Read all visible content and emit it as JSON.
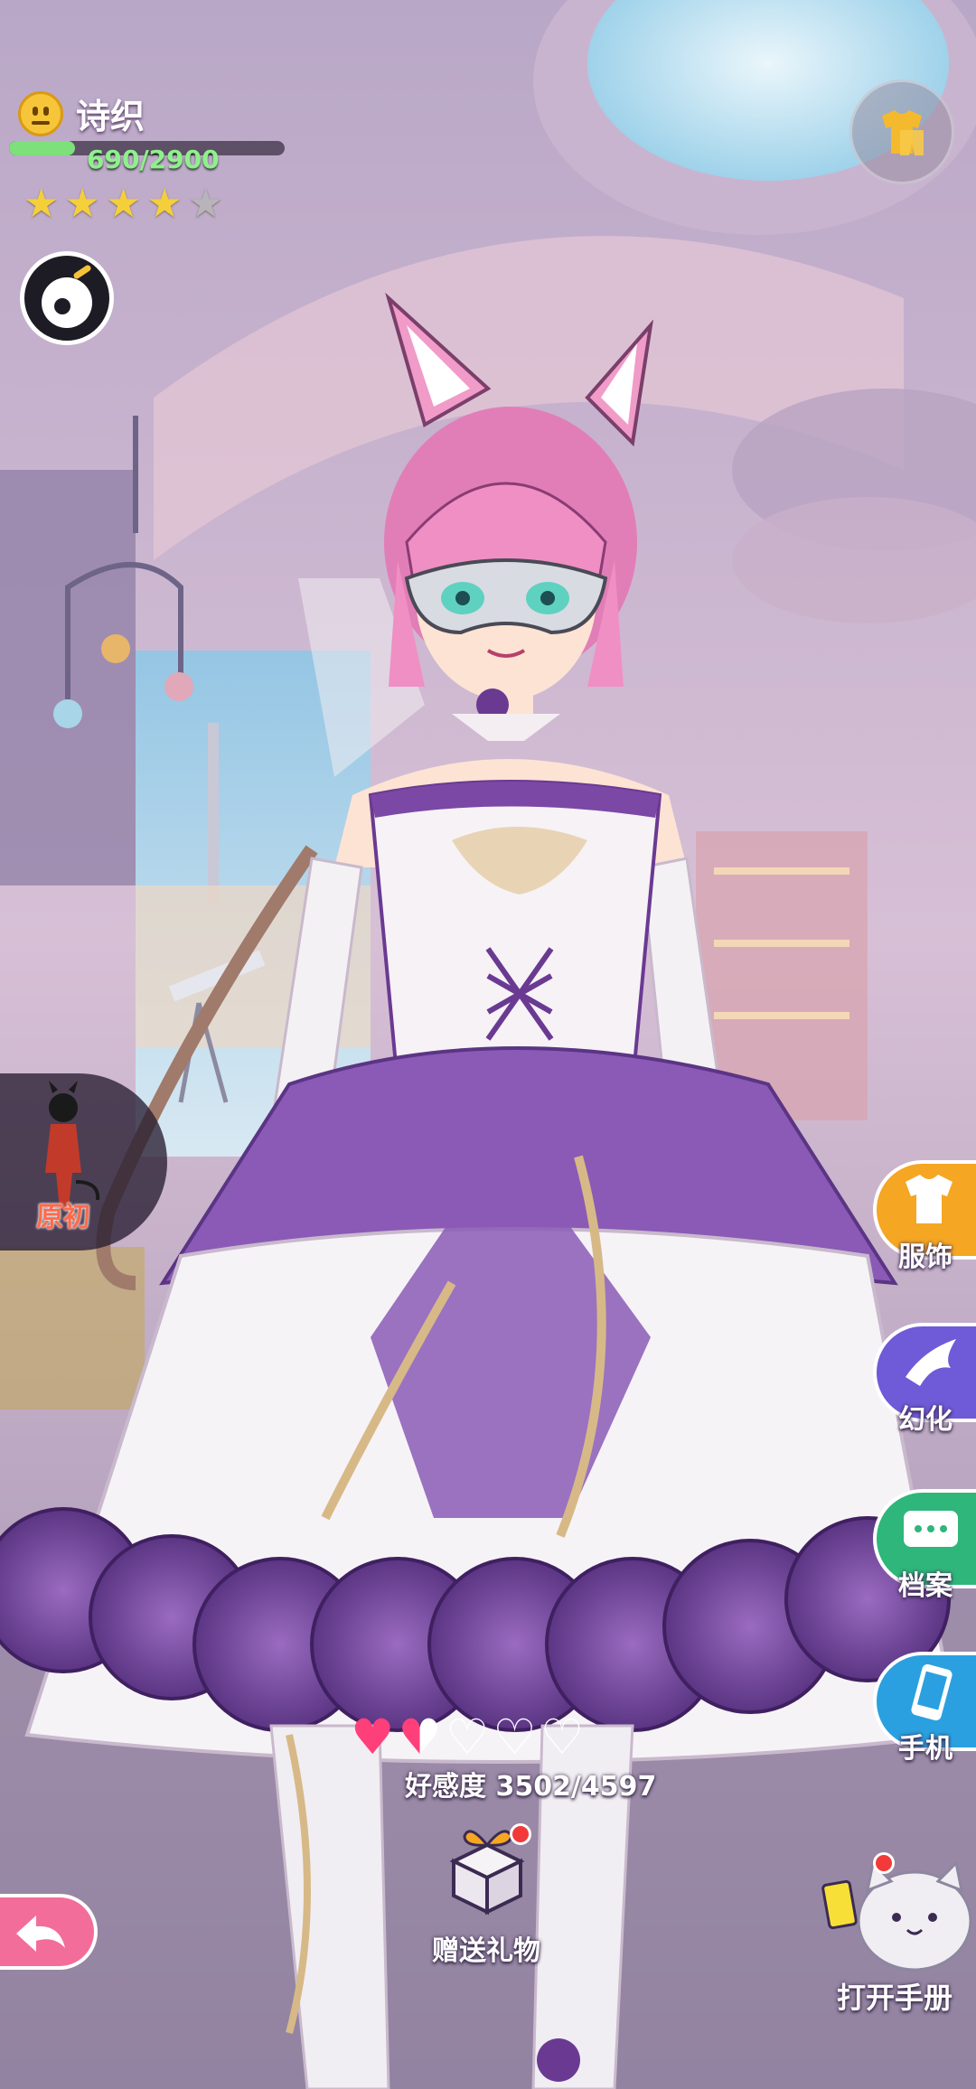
{
  "character": {
    "name": "诗织",
    "exp_text": "690/2900",
    "exp_value": 690,
    "exp_max": 2900,
    "stars_filled": 4,
    "stars_total": 5
  },
  "left_panel": {
    "original_label": "原初"
  },
  "side_menu": {
    "outfit_label": "服饰",
    "transform_label": "幻化",
    "profile_label": "档案",
    "phone_label": "手机"
  },
  "affection": {
    "label": "好感度 3502/4597",
    "value": 3502,
    "max": 4597,
    "hearts": [
      "full",
      "half",
      "empty",
      "empty",
      "empty"
    ]
  },
  "gift": {
    "label": "赠送礼物"
  },
  "handbook": {
    "label": "打开手册"
  },
  "colors": {
    "exp_fill": "#7de07a",
    "star_on": "#f5cf3a",
    "heart_full": "#ff3f7a",
    "outfit_btn": "#f5a623",
    "transform_btn": "#6f5ad8",
    "profile_btn": "#2fb67a",
    "phone_btn": "#2aa0e0",
    "back_btn": "#f36d9a"
  },
  "icons": [
    "mood-smile-icon",
    "camera-icon",
    "wardrobe-icon",
    "silhouette-icon",
    "shirt-icon",
    "bird-icon",
    "chat-icon",
    "phone-icon",
    "gift-icon",
    "back-arrow-icon",
    "cat-mascot-icon"
  ]
}
